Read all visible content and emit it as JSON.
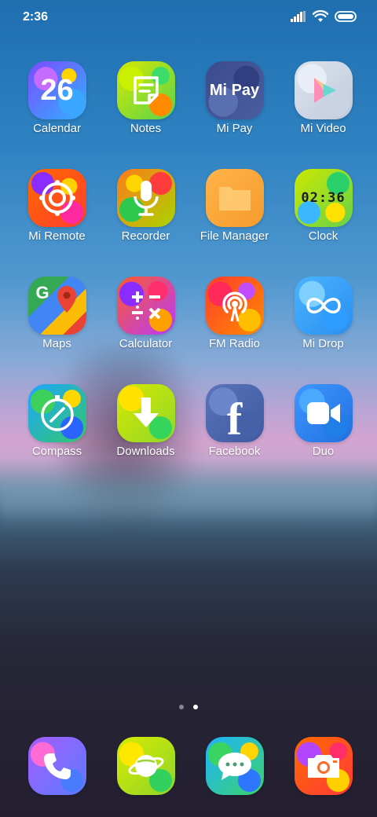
{
  "status_bar": {
    "time": "2:36",
    "icons": [
      "signal-icon",
      "wifi-icon",
      "battery-icon"
    ]
  },
  "apps": [
    {
      "label": "Calendar",
      "icon": "calendar-icon",
      "glyph": "26"
    },
    {
      "label": "Notes",
      "icon": "notes-icon"
    },
    {
      "label": "Mi Pay",
      "icon": "mi-pay-icon",
      "glyph": "Mi Pay"
    },
    {
      "label": "Mi Video",
      "icon": "mi-video-icon"
    },
    {
      "label": "Mi Remote",
      "icon": "mi-remote-icon"
    },
    {
      "label": "Recorder",
      "icon": "recorder-icon"
    },
    {
      "label": "File Manager",
      "icon": "file-manager-icon"
    },
    {
      "label": "Clock",
      "icon": "clock-icon",
      "glyph": "02:36"
    },
    {
      "label": "Maps",
      "icon": "maps-icon",
      "glyph": "G"
    },
    {
      "label": "Calculator",
      "icon": "calculator-icon"
    },
    {
      "label": "FM Radio",
      "icon": "fm-radio-icon"
    },
    {
      "label": "Mi Drop",
      "icon": "mi-drop-icon"
    },
    {
      "label": "Compass",
      "icon": "compass-icon"
    },
    {
      "label": "Downloads",
      "icon": "downloads-icon"
    },
    {
      "label": "Facebook",
      "icon": "facebook-icon",
      "glyph": "f"
    },
    {
      "label": "Duo",
      "icon": "duo-icon"
    }
  ],
  "pager": {
    "pages": 2,
    "current_page": 2
  },
  "dock": [
    {
      "icon": "phone-icon"
    },
    {
      "icon": "browser-icon"
    },
    {
      "icon": "messages-icon"
    },
    {
      "icon": "camera-icon"
    }
  ]
}
